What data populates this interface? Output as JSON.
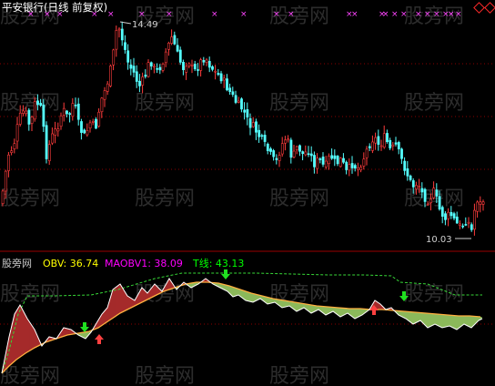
{
  "stock_title": "平安银行(日线 前复权)",
  "indicator": {
    "name": "股旁网",
    "obv_label": "OBV: 36.74",
    "maobv_label": "MAOBV1: 38.09",
    "t_label": "T线: 43.13"
  },
  "price_annotations": {
    "high": "14.49",
    "low": "10.03"
  },
  "watermark": "股旁网",
  "colors": {
    "background": "#000000",
    "up_candle": "#ff3c3c",
    "down_candle": "#54ffff",
    "grid": "#8a0000",
    "obv": "#ffffff",
    "maobv": "#ffb040",
    "tline": "#37d737",
    "fill_red": "#a52a2a",
    "fill_green": "#8bb85a",
    "signal_buy": "#ff4040",
    "signal_sell": "#20e020",
    "markers": "#ff44ff"
  },
  "icons": [
    "diamond-icon",
    "diamond-icon",
    "buy-arrow-icon",
    "sell-arrow-icon"
  ]
}
